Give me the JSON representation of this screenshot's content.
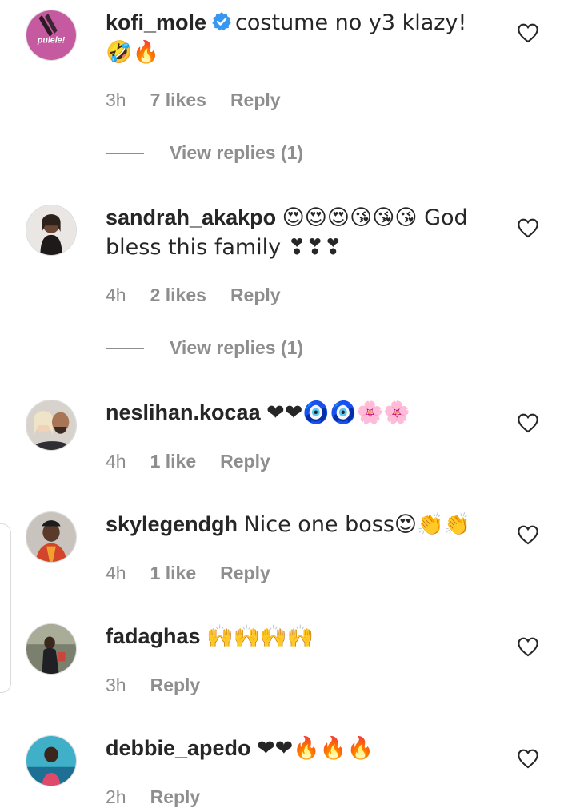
{
  "comments": [
    {
      "username": "kofi_mole",
      "verified": true,
      "text": "costume no y3 klazy! 🤣🔥",
      "time": "3h",
      "likes": "7 likes",
      "reply": "Reply",
      "view_replies": "View replies (1)",
      "avatar_brand": "pulele!"
    },
    {
      "username": "sandrah_akakpo",
      "verified": false,
      "text": "😍😍😍😘😘😘 God bless this family ❣❣❣",
      "time": "4h",
      "likes": "2 likes",
      "reply": "Reply",
      "view_replies": "View replies (1)"
    },
    {
      "username": "neslihan.kocaa",
      "verified": false,
      "text": "❤❤🧿🧿🌸🌸",
      "time": "4h",
      "likes": "1 like",
      "reply": "Reply"
    },
    {
      "username": "skylegendgh",
      "verified": false,
      "text": "Nice one boss😍👏👏",
      "time": "4h",
      "likes": "1 like",
      "reply": "Reply"
    },
    {
      "username": "fadaghas",
      "verified": false,
      "text": "🙌🙌🙌🙌",
      "time": "3h",
      "reply": "Reply"
    },
    {
      "username": "debbie_apedo",
      "verified": false,
      "text": "❤❤🔥🔥🔥",
      "time": "2h",
      "reply": "Reply"
    }
  ],
  "icons": {
    "heart": "heart-outline-icon",
    "verified": "verified-badge-icon"
  },
  "colors": {
    "text": "#262626",
    "meta": "#8e8e8e",
    "verified": "#3897f0"
  }
}
